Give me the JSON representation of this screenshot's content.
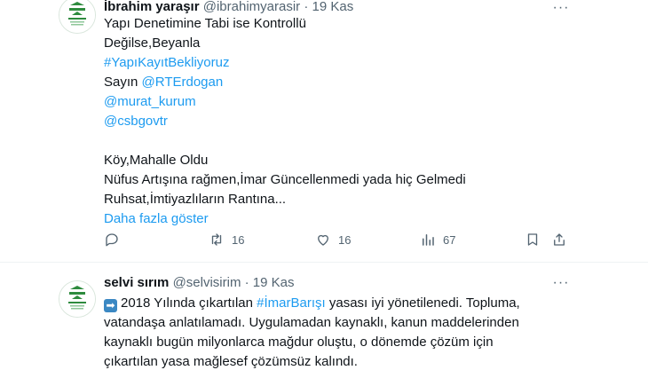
{
  "tweets": [
    {
      "author_name": "İbrahim yaraşır",
      "handle": "@ibrahimyarasir",
      "separator": "·",
      "time": "19 Kas",
      "more_label": "···",
      "lines": {
        "l1": "Yapı Denetimine Tabi ise Kontrollü",
        "l2": "Değilse,Beyanla",
        "l3": "#YapıKayıtBekliyoruz",
        "l4_prefix": "Sayın ",
        "l4_link": "@RTErdogan",
        "l5": "@murat_kurum",
        "l6": "@csbgovtr",
        "l7": "Köy,Mahalle Oldu",
        "l8": "Nüfus Artışına rağmen,İmar Güncellenmedi yada hiç Gelmedi",
        "l9": "Ruhsat,İmtiyazlıların Rantına..."
      },
      "show_more": "Daha fazla göster",
      "actions": {
        "reply_icon": "reply-icon",
        "retweet_icon": "retweet-icon",
        "retweet_count": "16",
        "like_icon": "like-icon",
        "like_count": "16",
        "views_icon": "views-icon",
        "views_count": "67",
        "bookmark_icon": "bookmark-icon",
        "share_icon": "share-icon"
      }
    },
    {
      "author_name": "selvi sırım",
      "handle": "@selvisirim",
      "separator": "·",
      "time": "19 Kas",
      "more_label": "···",
      "emoji": "➡",
      "lines": {
        "l1_a": "2018 Yılında çıkartılan ",
        "l1_link": "#İmarBarışı",
        "l1_b": " yasası iyi yönetilenedi. Topluma,",
        "l2": "vatandaşa anlatılamadı. Uygulamadan kaynaklı, kanun maddelerinden",
        "l3": "kaynaklı bugün milyonlarca mağdur oluştu, o dönemde çözüm için",
        "l4": "çıkartılan yasa mağlesef çözümsüz kalındı."
      }
    }
  ],
  "colors": {
    "text": "#0f1419",
    "secondary": "#536471",
    "link": "#1d9bf0",
    "divider": "#eff3f4",
    "logo_green": "#2e8b3e"
  }
}
